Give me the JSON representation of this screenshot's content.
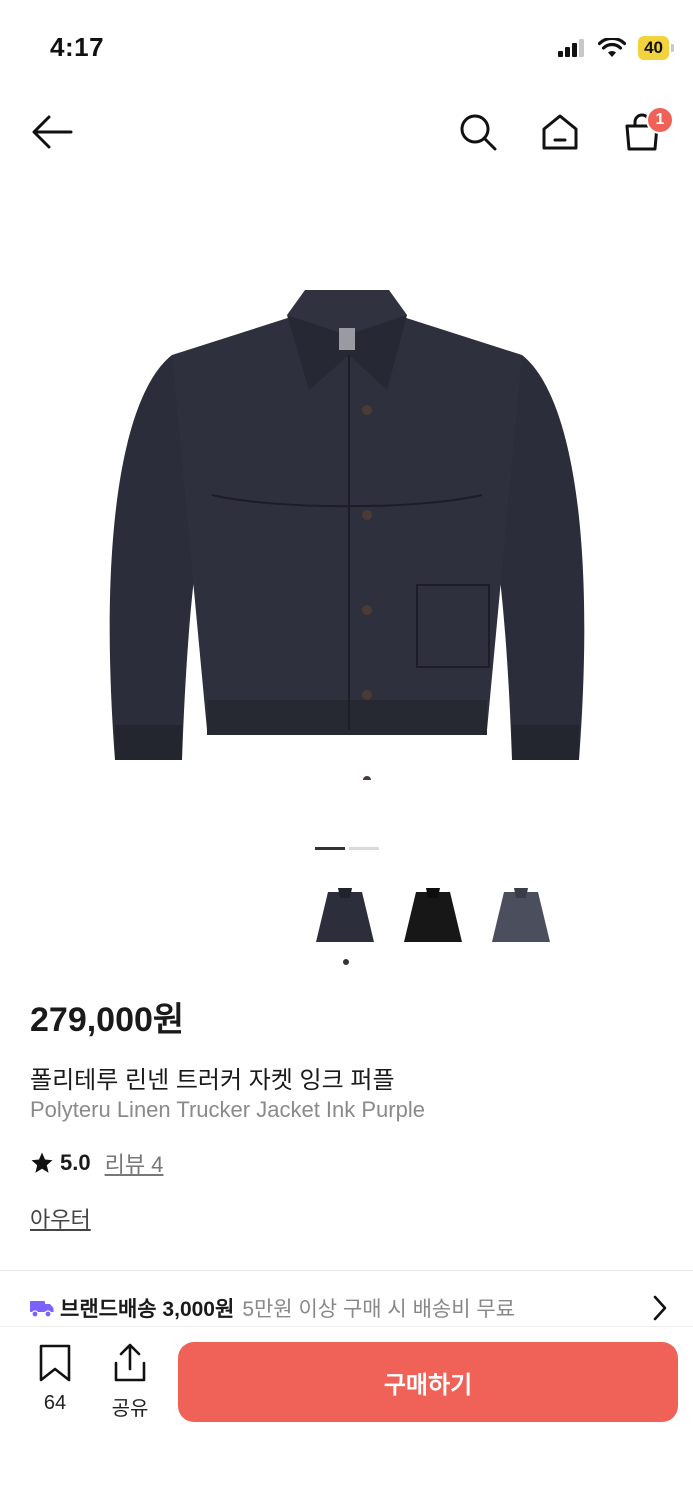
{
  "status": {
    "time": "4:17",
    "battery": "40"
  },
  "nav": {
    "cart_badge": "1"
  },
  "gallery": {
    "pages_total": 2,
    "active_page": 1,
    "colors": [
      "#2c2e3b",
      "#171717",
      "#4b4e5c"
    ]
  },
  "product": {
    "price": "279,000원",
    "name_ko": "폴리테루 린넨 트러커 자켓 잉크 퍼플",
    "name_en": "Polyteru Linen Trucker Jacket Ink Purple",
    "rating": "5.0",
    "review_label": "리뷰 4",
    "category": "아우터"
  },
  "shipping": {
    "label": "브랜드배송 3,000원",
    "note": "5만원 이상 구매 시 배송비 무료",
    "accent": "#7b61ff"
  },
  "bottom": {
    "save_count": "64",
    "share_label": "공유",
    "buy_label": "구매하기",
    "buy_color": "#f06258"
  }
}
